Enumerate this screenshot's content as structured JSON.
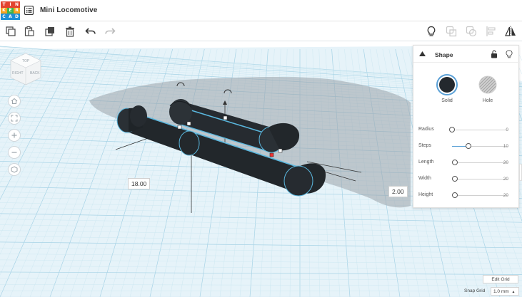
{
  "app": {
    "logo_letters": [
      "T",
      "I",
      "N",
      "K",
      "E",
      "R",
      "C",
      "A",
      "D"
    ],
    "logo_colors": [
      "#e3432f",
      "#e3432f",
      "#e3432f",
      "#f6a21c",
      "#3cb54a",
      "#f6a21c",
      "#1d8fd6",
      "#1d8fd6",
      "#1d8fd6"
    ],
    "design_title": "Mini Locomotive"
  },
  "toolbar": {
    "left_icons": [
      "copy-icon",
      "paste-icon",
      "duplicate-icon",
      "delete-icon",
      "undo-icon",
      "redo-icon"
    ],
    "right_icons": [
      "lightbulb-icon",
      "group-icon",
      "ungroup-icon",
      "align-icon",
      "mirror-icon"
    ]
  },
  "viewcube": {
    "right_face": "RIGHT",
    "back_face": "BACK",
    "top_face": "TOP"
  },
  "workplane": {
    "dimension_length": "18.00",
    "dimension_height": "2.00"
  },
  "shape_panel": {
    "title": "Shape",
    "solid_label": "Solid",
    "hole_label": "Hole",
    "properties": [
      {
        "label": "Radius",
        "value": "0",
        "fraction": 0.0
      },
      {
        "label": "Steps",
        "value": "10",
        "fraction": 0.3
      },
      {
        "label": "Length",
        "value": "20",
        "fraction": 0.05
      },
      {
        "label": "Width",
        "value": "20",
        "fraction": 0.05
      },
      {
        "label": "Height",
        "value": "20",
        "fraction": 0.05
      }
    ],
    "colors": {
      "solid": "#24292e",
      "accent": "#5aa0d6"
    }
  },
  "footer": {
    "edit_grid": "Edit Grid",
    "snap_grid_label": "Snap Grid",
    "snap_grid_value": "1.0 mm"
  }
}
